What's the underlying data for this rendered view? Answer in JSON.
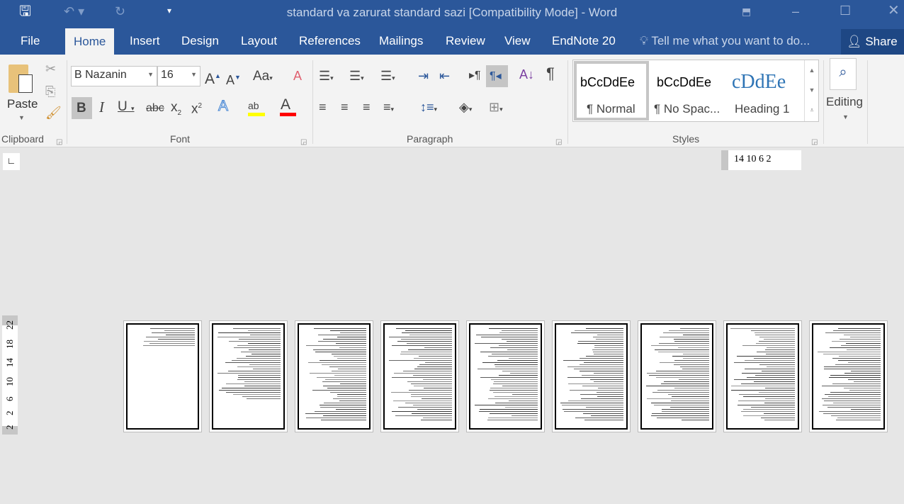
{
  "window": {
    "title": "standard va zarurat standard sazi [Compatibility Mode] - Word"
  },
  "tabs": [
    {
      "label": "File"
    },
    {
      "label": "Home"
    },
    {
      "label": "Insert"
    },
    {
      "label": "Design"
    },
    {
      "label": "Layout"
    },
    {
      "label": "References"
    },
    {
      "label": "Mailings"
    },
    {
      "label": "Review"
    },
    {
      "label": "View"
    },
    {
      "label": "EndNote 20"
    }
  ],
  "tell_me": {
    "placeholder": "Tell me what you want to do..."
  },
  "share": {
    "label": "Share"
  },
  "clipboard": {
    "paste": "Paste",
    "group": "Clipboard"
  },
  "font": {
    "name": "B Nazanin",
    "size": "16",
    "change_case": "Aa",
    "group": "Font",
    "highlight_color": "#ffff00",
    "font_color": "#ff0000"
  },
  "paragraph": {
    "group": "Paragraph"
  },
  "styles": {
    "group": "Styles",
    "items": [
      {
        "preview": "bCcDdEe",
        "label": "¶ Normal"
      },
      {
        "preview": "bCcDdEe",
        "label": "¶ No Spac..."
      },
      {
        "preview": "cDdEe",
        "label": "Heading 1"
      }
    ]
  },
  "editing": {
    "label": "Editing"
  },
  "ruler": {
    "horizontal": "14 10 6  2",
    "vertical": [
      "2",
      "2",
      "6",
      "10",
      "14",
      "18",
      "22"
    ]
  },
  "pages": {
    "count": 9
  },
  "colors": {
    "brand": "#2b579a"
  }
}
